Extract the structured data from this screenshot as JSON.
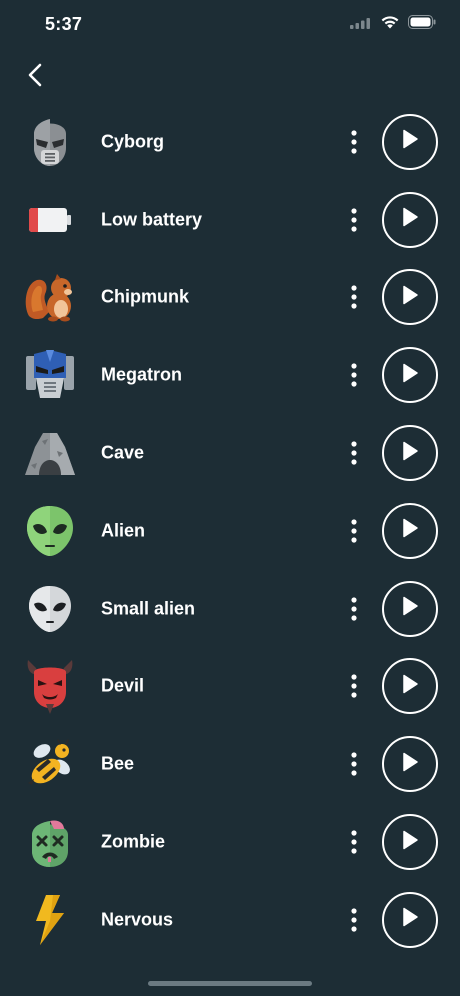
{
  "status_bar": {
    "time": "5:37"
  },
  "sounds": [
    {
      "label": "Cyborg",
      "icon": "cyborg-icon"
    },
    {
      "label": "Low battery",
      "icon": "low-battery-icon"
    },
    {
      "label": "Chipmunk",
      "icon": "chipmunk-icon"
    },
    {
      "label": "Megatron",
      "icon": "megatron-icon"
    },
    {
      "label": "Cave",
      "icon": "cave-icon"
    },
    {
      "label": "Alien",
      "icon": "alien-icon"
    },
    {
      "label": "Small alien",
      "icon": "small-alien-icon"
    },
    {
      "label": "Devil",
      "icon": "devil-icon"
    },
    {
      "label": "Bee",
      "icon": "bee-icon"
    },
    {
      "label": "Zombie",
      "icon": "zombie-icon"
    },
    {
      "label": "Nervous",
      "icon": "lightning-icon"
    }
  ],
  "colors": {
    "background": "#1d2d35",
    "foreground": "#ffffff"
  }
}
